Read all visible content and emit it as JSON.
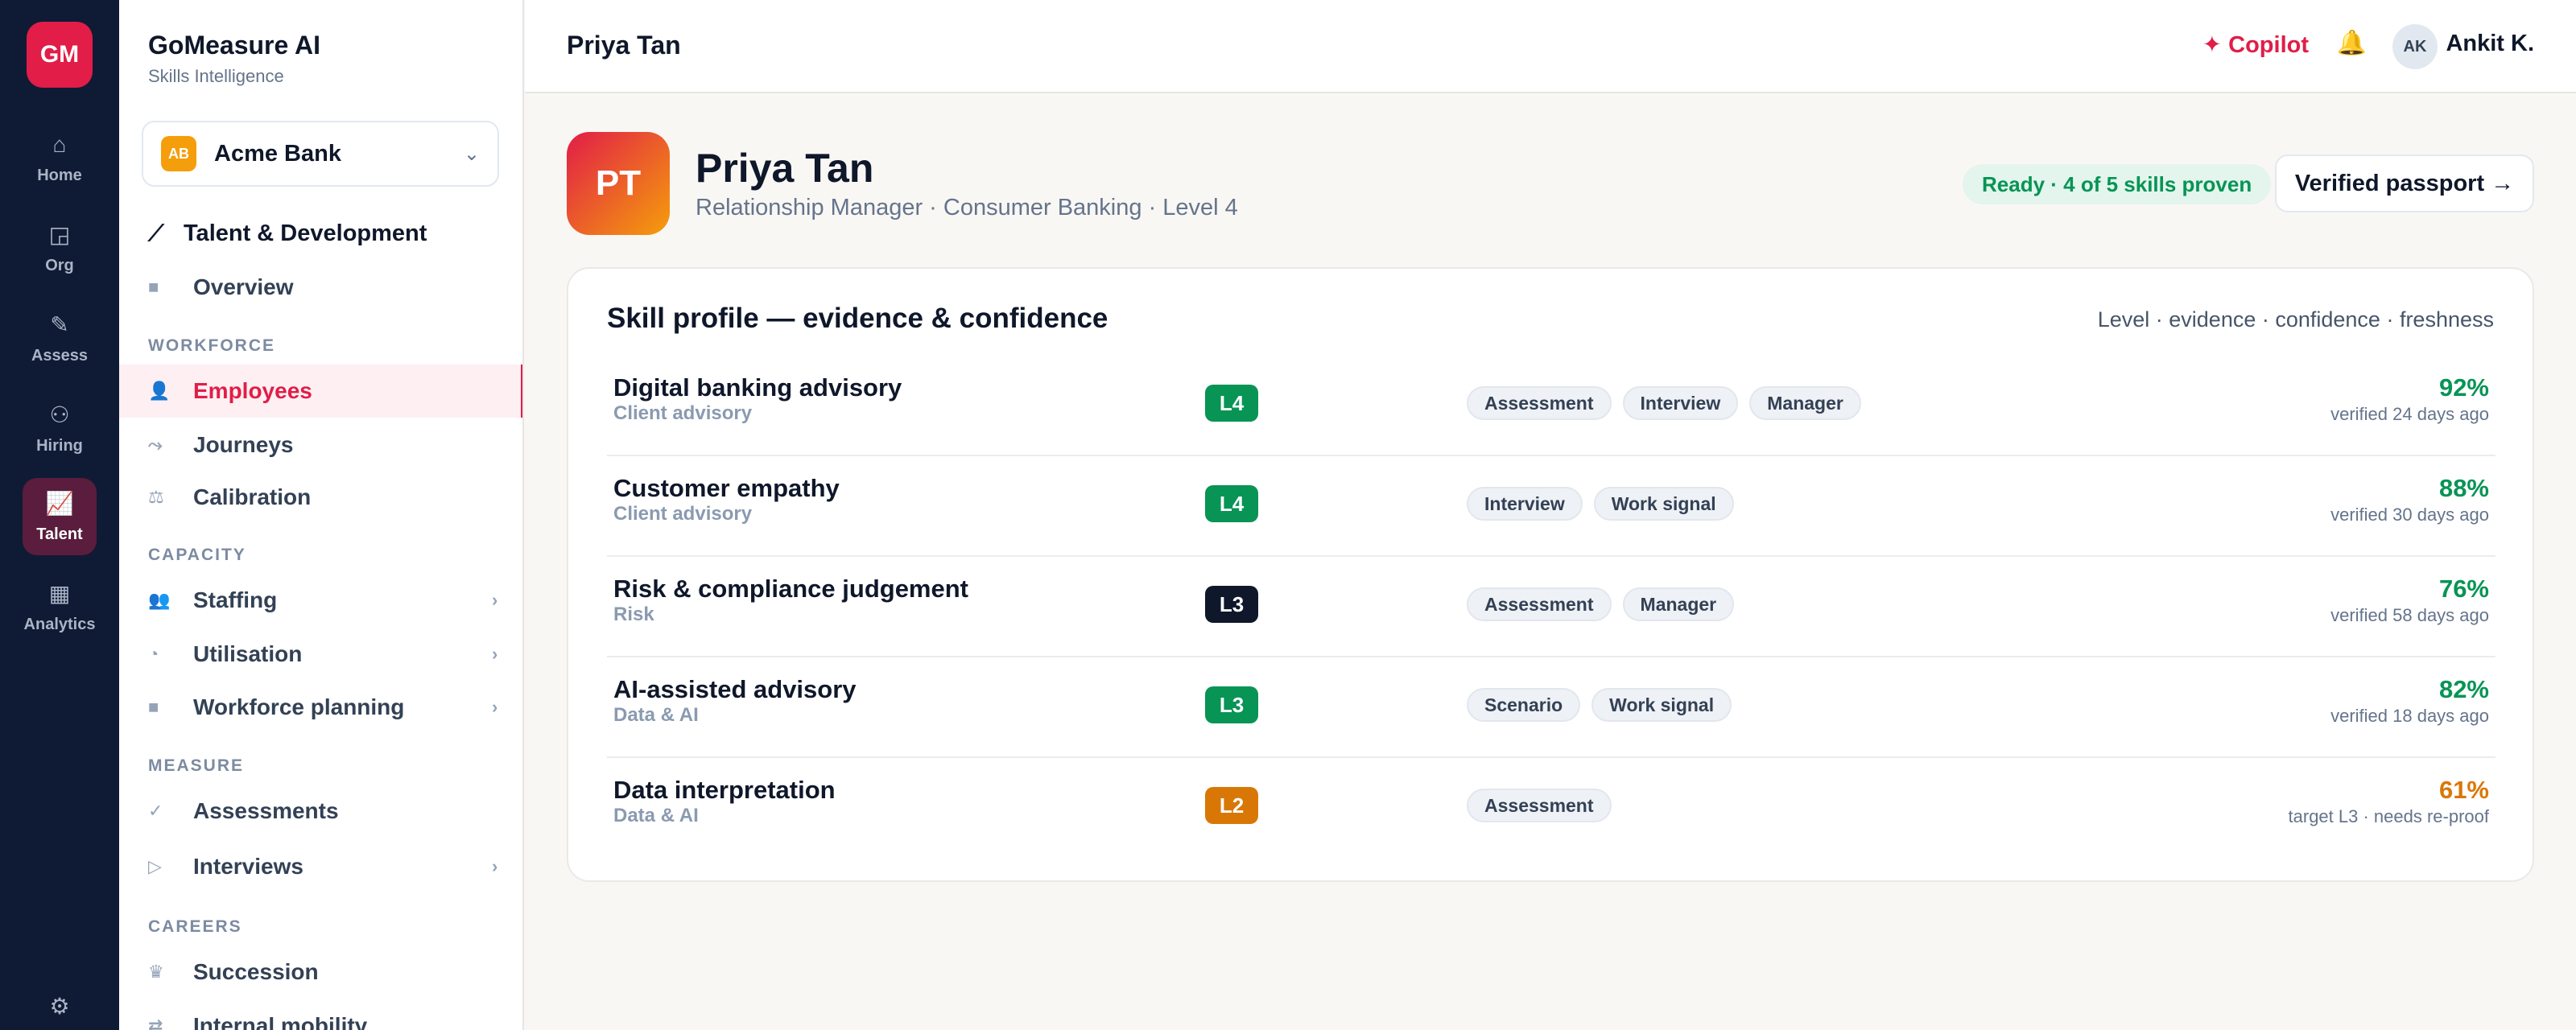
{
  "rail": {
    "logo": "GM",
    "items": [
      {
        "label": "Home",
        "icon": "⌂"
      },
      {
        "label": "Org",
        "icon": "◲"
      },
      {
        "label": "Assess",
        "icon": "✎"
      },
      {
        "label": "Hiring",
        "icon": "⚇"
      },
      {
        "label": "Talent",
        "icon": "📈"
      },
      {
        "label": "Analytics",
        "icon": "▦"
      }
    ],
    "settings_icon": "⚙"
  },
  "sidebar": {
    "app_title": "GoMeasure AI",
    "app_subtitle": "Skills Intelligence",
    "org": {
      "badge": "AB",
      "name": "Acme Bank",
      "chevron": "⌄"
    },
    "module": {
      "icon": "⟋",
      "label": "Talent & Development"
    },
    "overview": {
      "icon": "■",
      "label": "Overview"
    },
    "sections": {
      "workforce": "WORKFORCE",
      "capacity": "CAPACITY",
      "measure": "MEASURE",
      "careers": "CAREERS"
    },
    "items": {
      "employees": {
        "icon": "👤",
        "label": "Employees"
      },
      "journeys": {
        "icon": "⤳",
        "label": "Journeys"
      },
      "calibration": {
        "icon": "⚖",
        "label": "Calibration"
      },
      "staffing": {
        "icon": "👥",
        "label": "Staffing",
        "chevron": "›"
      },
      "utilisation": {
        "icon": "◔",
        "label": "Utilisation",
        "chevron": "›"
      },
      "workforce_planning": {
        "icon": "■",
        "label": "Workforce planning",
        "chevron": "›"
      },
      "assessments": {
        "icon": "✓",
        "label": "Assessments"
      },
      "interviews": {
        "icon": "▷",
        "label": "Interviews",
        "chevron": "›"
      },
      "succession": {
        "icon": "♛",
        "label": "Succession"
      },
      "internal_mobility": {
        "icon": "⇄",
        "label": "Internal mobility"
      }
    }
  },
  "topbar": {
    "breadcrumb": "Priya Tan",
    "copilot": "✦ Copilot",
    "bell_icon": "🔔",
    "avatar": "AK",
    "user": "Ankit K."
  },
  "profile": {
    "initials": "PT",
    "name": "Priya Tan",
    "subtitle": "Relationship Manager · Consumer Banking · Level 4",
    "status": "Ready · 4 of 5 skills proven",
    "passport_button": "Verified passport →"
  },
  "skills": {
    "title": "Skill profile — evidence & confidence",
    "legend": "Level · evidence · confidence · freshness",
    "rows": [
      {
        "name": "Digital banking advisory",
        "category": "Client advisory",
        "level": "L4",
        "level_color": "#079455",
        "evidence": [
          "Assessment",
          "Interview",
          "Manager"
        ],
        "confidence": "92%",
        "conf_color": "#079455",
        "freshness": "verified 24 days ago"
      },
      {
        "name": "Customer empathy",
        "category": "Client advisory",
        "level": "L4",
        "level_color": "#079455",
        "evidence": [
          "Interview",
          "Work signal"
        ],
        "confidence": "88%",
        "conf_color": "#079455",
        "freshness": "verified 30 days ago"
      },
      {
        "name": "Risk & compliance judgement",
        "category": "Risk",
        "level": "L3",
        "level_color": "#0f172a",
        "evidence": [
          "Assessment",
          "Manager"
        ],
        "confidence": "76%",
        "conf_color": "#079455",
        "freshness": "verified 58 days ago"
      },
      {
        "name": "AI-assisted advisory",
        "category": "Data & AI",
        "level": "L3",
        "level_color": "#079455",
        "evidence": [
          "Scenario",
          "Work signal"
        ],
        "confidence": "82%",
        "conf_color": "#079455",
        "freshness": "verified 18 days ago"
      },
      {
        "name": "Data interpretation",
        "category": "Data & AI",
        "level": "L2",
        "level_color": "#d97706",
        "evidence": [
          "Assessment"
        ],
        "confidence": "61%",
        "conf_color": "#d97706",
        "freshness": "target L3 · needs re-proof"
      }
    ]
  }
}
